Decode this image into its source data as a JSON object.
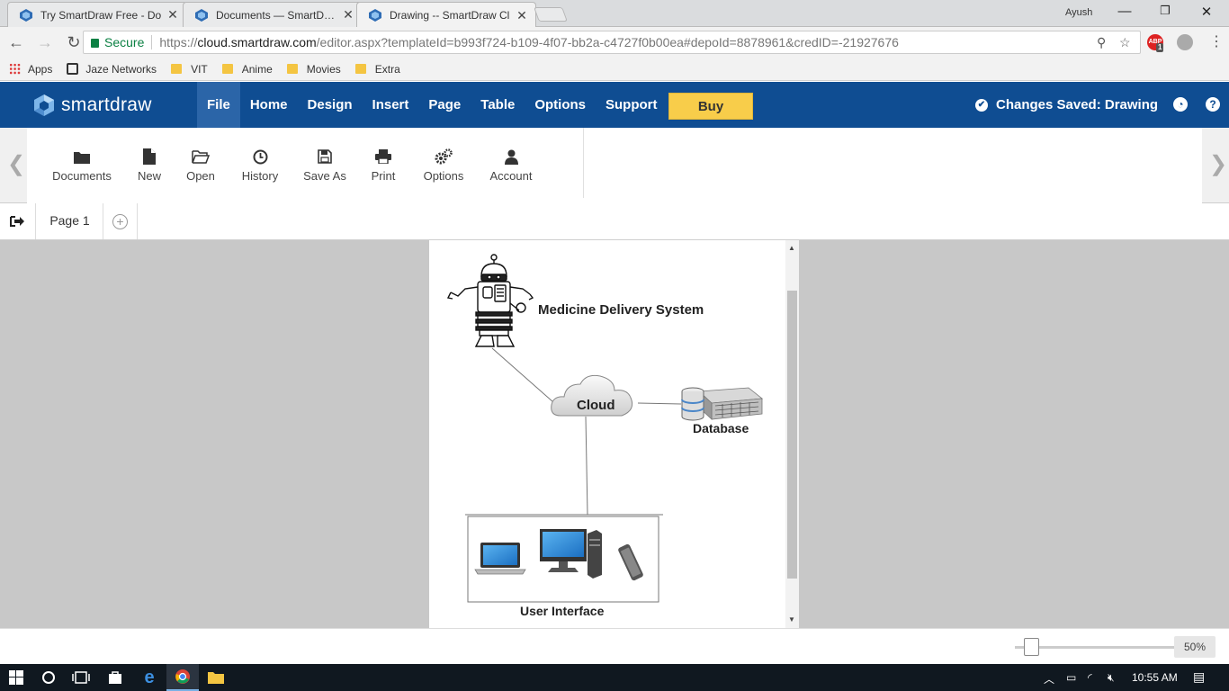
{
  "browser": {
    "tabs": [
      {
        "title": "Try SmartDraw Free - Do",
        "active": false
      },
      {
        "title": "Documents — SmartDraw",
        "active": false
      },
      {
        "title": "Drawing -- SmartDraw Cl",
        "active": true
      }
    ],
    "user": "Ayush",
    "security_label": "Secure",
    "url_scheme": "https://",
    "url_host": "cloud.smartdraw.com",
    "url_rest": "/editor.aspx?templateId=b993f724-b109-4f07-bb2a-c4727f0b00ea#depoId=8878961&credID=-21927676",
    "extension_badge": "1",
    "bookmarks": [
      "Apps",
      "Jaze Networks",
      "VIT",
      "Anime",
      "Movies",
      "Extra"
    ]
  },
  "app": {
    "logo_text": "smartdraw",
    "menu": [
      "File",
      "Home",
      "Design",
      "Insert",
      "Page",
      "Table",
      "Options",
      "Support"
    ],
    "active_menu": "File",
    "buy_label": "Buy",
    "status": "Changes Saved: Drawing",
    "brand_color": "#0f4d92",
    "buy_color": "#f8cd4a"
  },
  "ribbon": {
    "buttons": [
      {
        "label": "Documents",
        "icon": "folder-icon"
      },
      {
        "label": "New",
        "icon": "file-icon"
      },
      {
        "label": "Open",
        "icon": "folder-open-icon"
      },
      {
        "label": "History",
        "icon": "clock-icon"
      },
      {
        "label": "Save As",
        "icon": "save-icon"
      },
      {
        "label": "Print",
        "icon": "printer-icon"
      },
      {
        "label": "Options",
        "icon": "gears-icon"
      },
      {
        "label": "Account",
        "icon": "user-icon"
      }
    ]
  },
  "pages": {
    "tabs": [
      "Page 1"
    ]
  },
  "diagram": {
    "robot_label": "Medicine Delivery System",
    "cloud_label": "Cloud",
    "database_label": "Database",
    "ui_label": "User Interface"
  },
  "zoom": {
    "value": "50%",
    "level": 0.08
  },
  "taskbar": {
    "time": "10:55 AM"
  }
}
